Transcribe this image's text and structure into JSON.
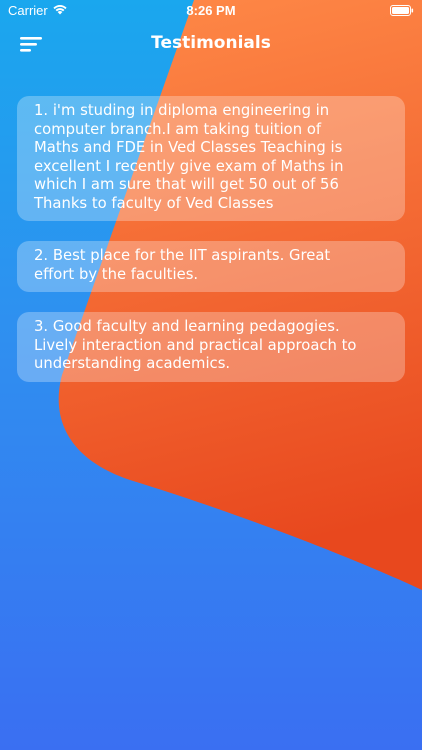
{
  "status_bar": {
    "carrier": "Carrier",
    "time": "8:26 PM",
    "icons": [
      "wifi-icon",
      "battery-icon"
    ]
  },
  "nav": {
    "title": "Testimonials",
    "menu_icon": "hamburger-menu-icon"
  },
  "colors": {
    "background_blue_top": "#1aa7ee",
    "background_blue_bottom": "#3a6ff2",
    "orange_top": "#ff8a48",
    "orange_bottom": "#e8481e",
    "card_fill": "rgba(255,255,255,0.28)",
    "text": "#ffffff"
  },
  "testimonials": [
    {
      "lines": [
        "1. i'm studing in diploma engineering in",
        "computer branch.I am taking tuition of",
        "Maths and FDE in Ved Classes Teaching is",
        "excellent I recently give exam of Maths in",
        "which I am sure that will get 50 out of 56",
        "Thanks to faculty of Ved Classes"
      ]
    },
    {
      "lines": [
        "2. Best place for the IIT aspirants. Great",
        "effort by the faculties."
      ]
    },
    {
      "lines": [
        "3. Good faculty and learning pedagogies.",
        "Lively interaction and practical approach to",
        "understanding academics."
      ]
    }
  ]
}
